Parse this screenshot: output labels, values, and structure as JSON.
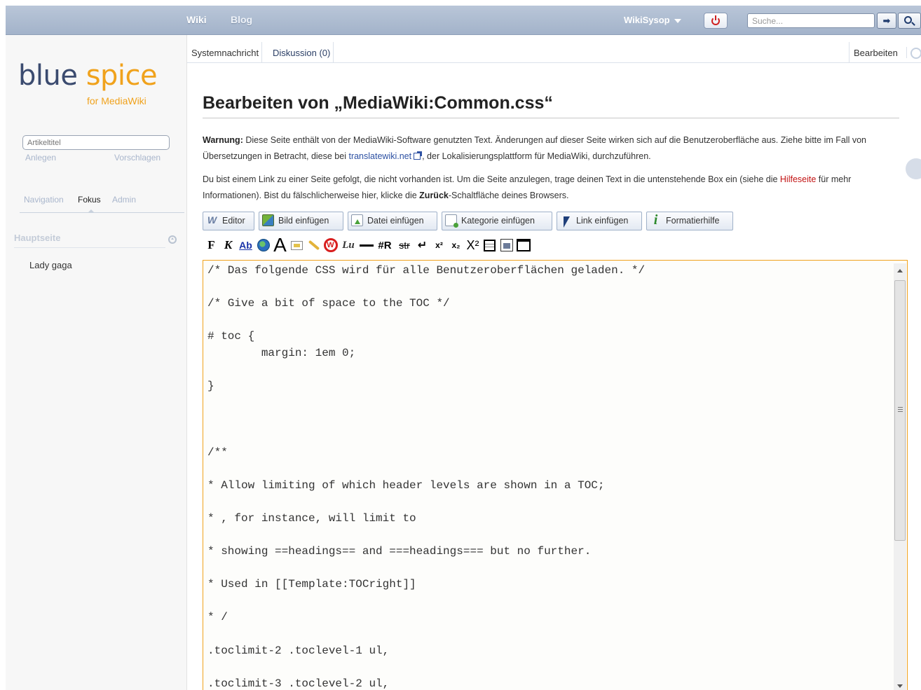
{
  "topbar": {
    "nav": [
      "Wiki",
      "Blog"
    ],
    "user": "WikiSysop",
    "search_placeholder": "Suche...",
    "go_symbol": "➡"
  },
  "sidebar": {
    "logo_word_1": "blue",
    "logo_word_2": "spice",
    "logo_sub": "for MediaWiki",
    "title_placeholder": "Artikeltitel",
    "create": "Anlegen",
    "suggest": "Vorschlagen",
    "tabs": [
      "Navigation",
      "Fokus",
      "Admin"
    ],
    "section": "Hauptseite",
    "items": [
      "Lady gaga"
    ]
  },
  "tabs": {
    "system": "Systemnachricht",
    "discussion": "Diskussion (0)",
    "edit": "Bearbeiten"
  },
  "page": {
    "title": "Bearbeiten von „MediaWiki:Common.css“",
    "warning_label": "Warnung:",
    "warning_text_1": " Diese Seite enthält von der MediaWiki-Software genutzten Text. Änderungen auf dieser Seite wirken sich auf die Benutzeroberfläche aus. Ziehe bitte im Fall von Übersetzungen in Betracht, diese bei ",
    "warning_link": "translatewiki.net",
    "warning_text_2": ", der Lokalisierungsplattform für MediaWiki, durchzuführen.",
    "notice_text_1": "Du bist einem Link zu einer Seite gefolgt, die nicht vorhanden ist. Um die Seite anzulegen, trage deinen Text in die untenstehende Box ein (siehe die ",
    "notice_link": "Hilfeseite",
    "notice_text_2": " für mehr Informationen). Bist du fälschlicherweise hier, klicke die ",
    "notice_bold": "Zurück",
    "notice_text_3": "-Schaltfläche deines Browsers."
  },
  "toolbar": {
    "buttons": [
      {
        "label": "Editor",
        "icon": "wysiwyg-icon"
      },
      {
        "label": "Bild einfügen",
        "icon": "image-insert-icon"
      },
      {
        "label": "Datei einfügen",
        "icon": "file-insert-icon"
      },
      {
        "label": "Kategorie einfügen",
        "icon": "category-insert-icon"
      },
      {
        "label": "Link einfügen",
        "icon": "link-cursor-icon"
      },
      {
        "label": "Formatierhilfe",
        "icon": "info-icon"
      }
    ],
    "strip": {
      "bold": "F",
      "italic": "K",
      "link": "Ab",
      "headline": "A",
      "nowiki": "W",
      "redirect": "#R",
      "strike": "str",
      "linebreak": "↵",
      "sup": "x²",
      "sub": "x₂",
      "big": "X²",
      "signature": "Lu"
    }
  },
  "editor": {
    "content": "/* Das folgende CSS wird für alle Benutzeroberflächen geladen. */\n\n/* Give a bit of space to the TOC */\n\n# toc {\n        margin: 1em 0;\n\n}\n\n\n\n/**\n\n* Allow limiting of which header levels are shown in a TOC;\n\n* , for instance, will limit to\n\n* showing ==headings== and ===headings=== but no further.\n\n* Used in [[Template:TOCright]]\n\n* /\n\n.toclimit-2 .toclevel-1 ul,\n\n.toclimit-3 .toclevel-2 ul,"
  },
  "colors": {
    "brand_blue": "#3b4b6f",
    "brand_orange": "#f0a21c",
    "topbar": "#a3b3ca",
    "link": "#2d51a3",
    "red_link": "#c21212"
  }
}
